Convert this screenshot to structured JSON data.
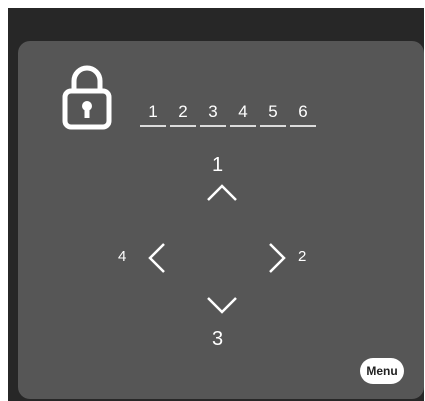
{
  "code_entry": {
    "digits": [
      "1",
      "2",
      "3",
      "4",
      "5",
      "6"
    ]
  },
  "directions": {
    "up_label": "1",
    "right_label": "2",
    "down_label": "3",
    "left_label": "4"
  },
  "menu": {
    "label": "Menu"
  },
  "icons": [
    "lock-icon",
    "chevron-up-icon",
    "chevron-down-icon",
    "chevron-left-icon",
    "chevron-right-icon"
  ],
  "colors": {
    "background": "#272727",
    "panel": "#565656",
    "foreground": "#ffffff"
  }
}
